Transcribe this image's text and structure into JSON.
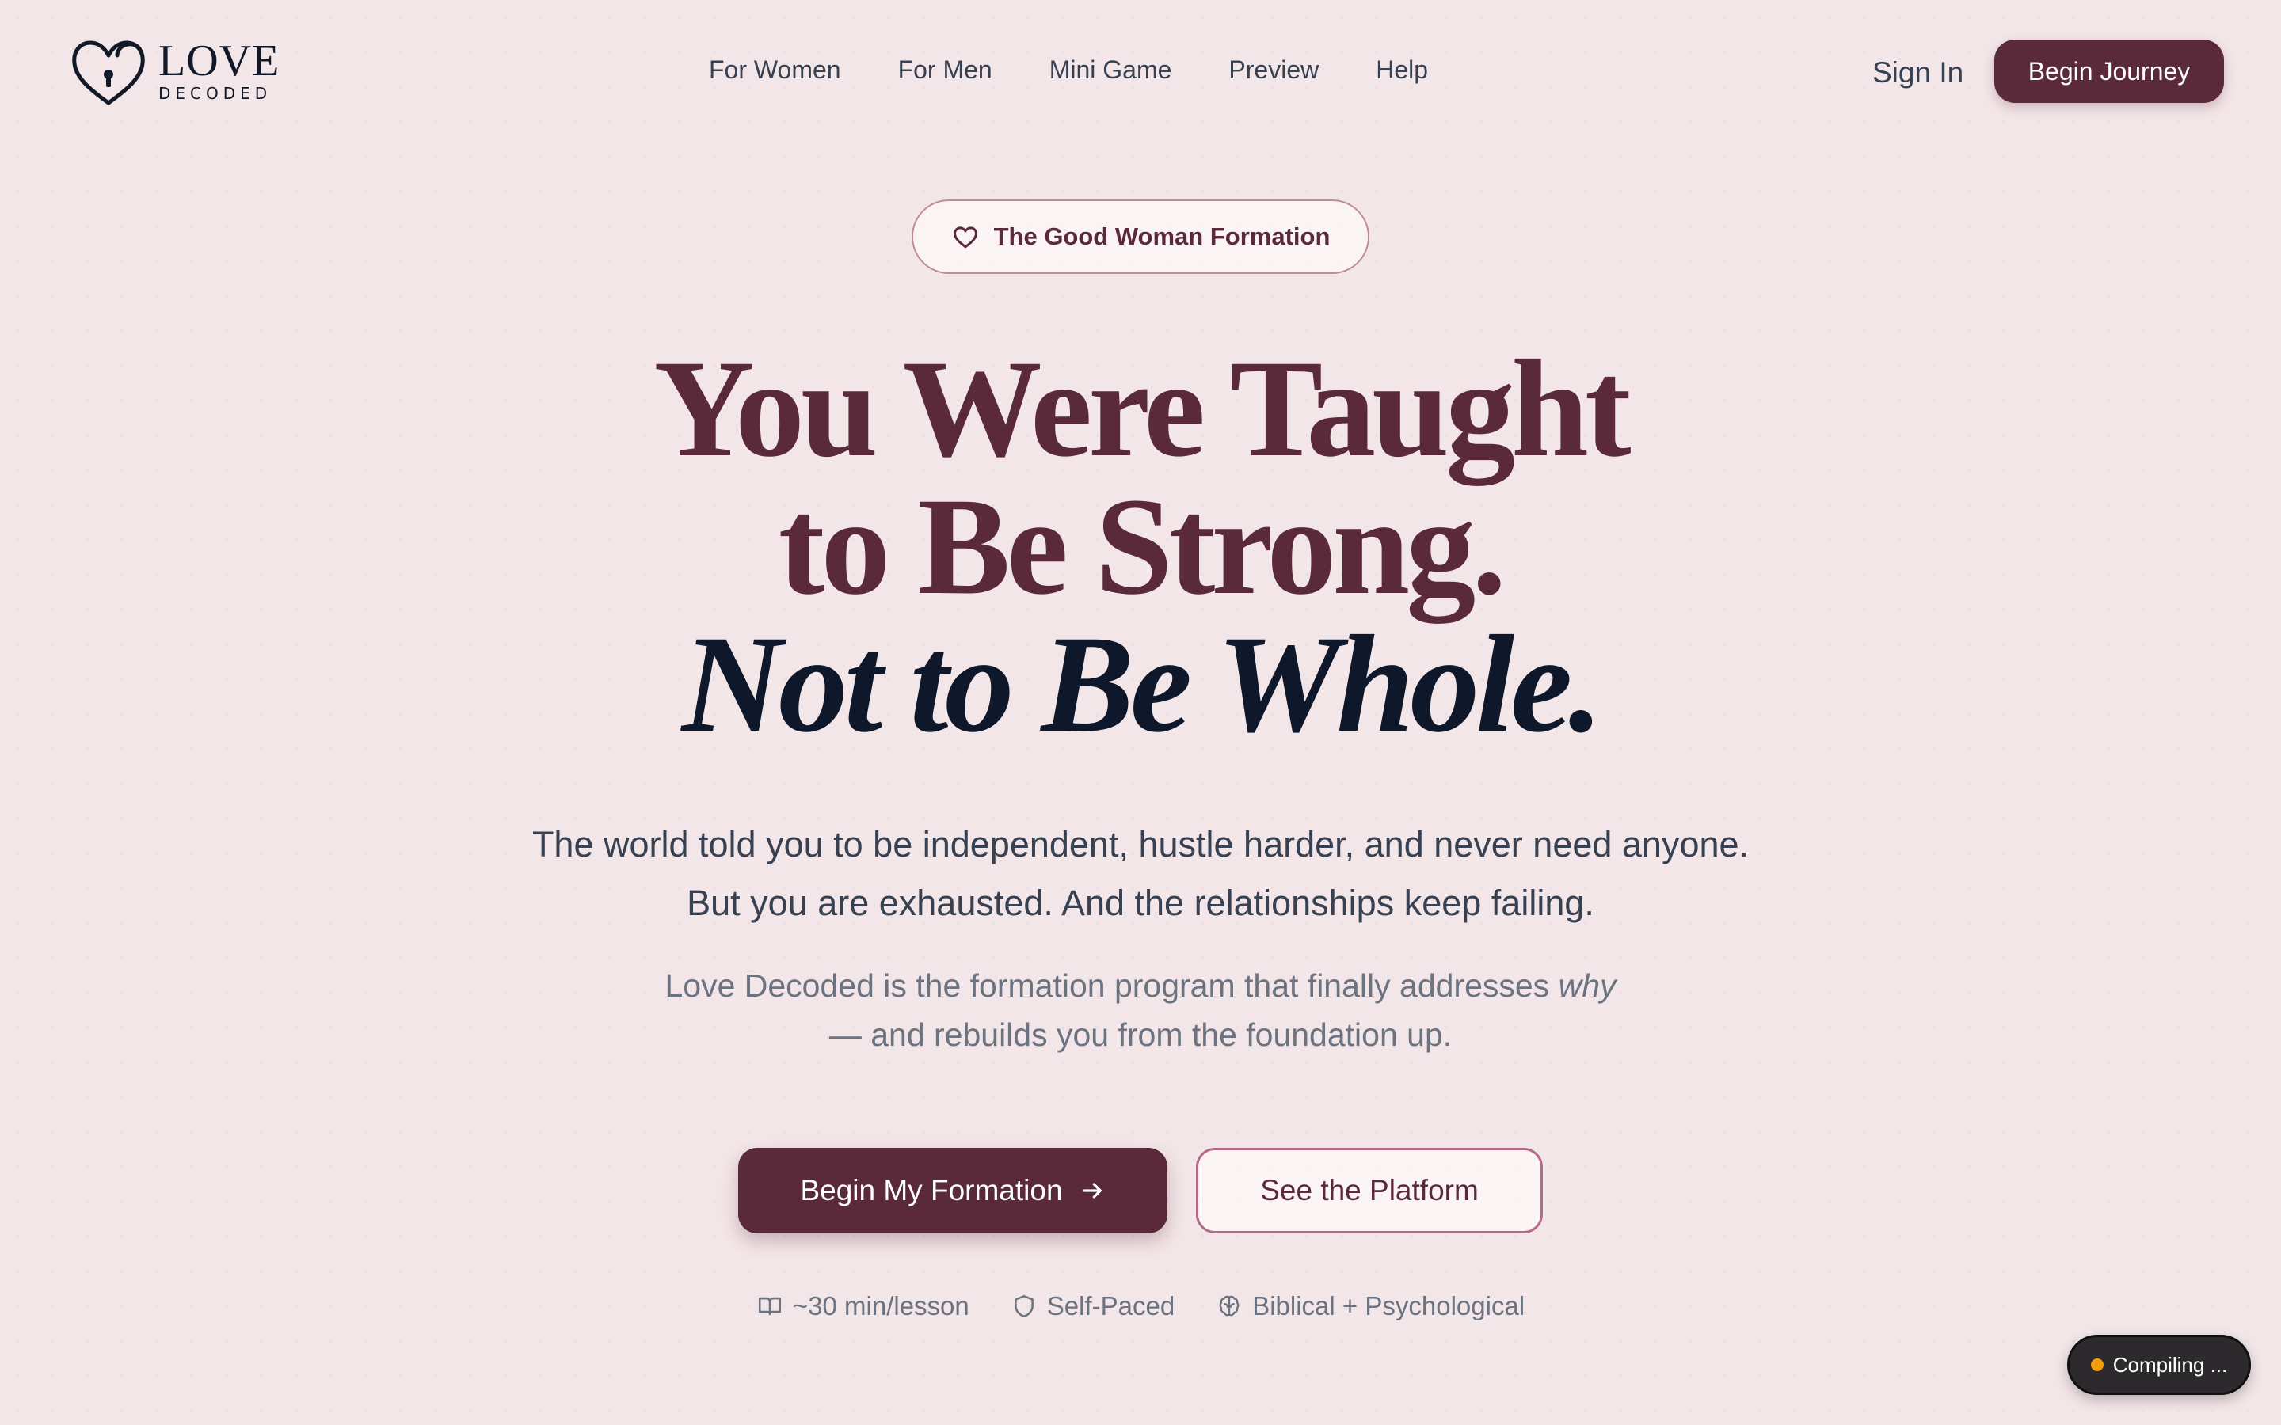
{
  "header": {
    "logo": {
      "word": "LOVE",
      "sub": "DECODED",
      "icon": "heart-lock-icon"
    },
    "nav": [
      {
        "label": "For Women"
      },
      {
        "label": "For Men"
      },
      {
        "label": "Mini Game"
      },
      {
        "label": "Preview"
      },
      {
        "label": "Help"
      }
    ],
    "sign_in": "Sign In",
    "cta": "Begin Journey"
  },
  "hero": {
    "badge": {
      "icon": "heart-icon",
      "label": "The Good Woman Formation"
    },
    "headline": {
      "line1": "You Were Taught",
      "line2": "to Be Strong.",
      "line3": "Not to Be Whole."
    },
    "lead": "The world told you to be independent, hustle harder, and never need anyone. But you are exhausted. And the relationships keep failing.",
    "sub": {
      "before": "Love Decoded is the formation program that finally addresses",
      "emphasis": "why",
      "after": "— and rebuilds you from the foundation up."
    },
    "primary_cta": {
      "label": "Begin My Formation",
      "icon": "arrow-right-icon"
    },
    "secondary_cta": {
      "label": "See the Platform"
    },
    "features": [
      {
        "icon": "book-icon",
        "label": "~30 min/lesson"
      },
      {
        "icon": "shield-icon",
        "label": "Self-Paced"
      },
      {
        "icon": "brain-icon",
        "label": "Biblical + Psychological"
      }
    ]
  },
  "status": {
    "label": "Compiling ...",
    "dot_color": "#f59e0b"
  },
  "colors": {
    "brand": "#5a2a3a",
    "background": "#f3e6e8",
    "headline_dark": "#0f172a"
  }
}
